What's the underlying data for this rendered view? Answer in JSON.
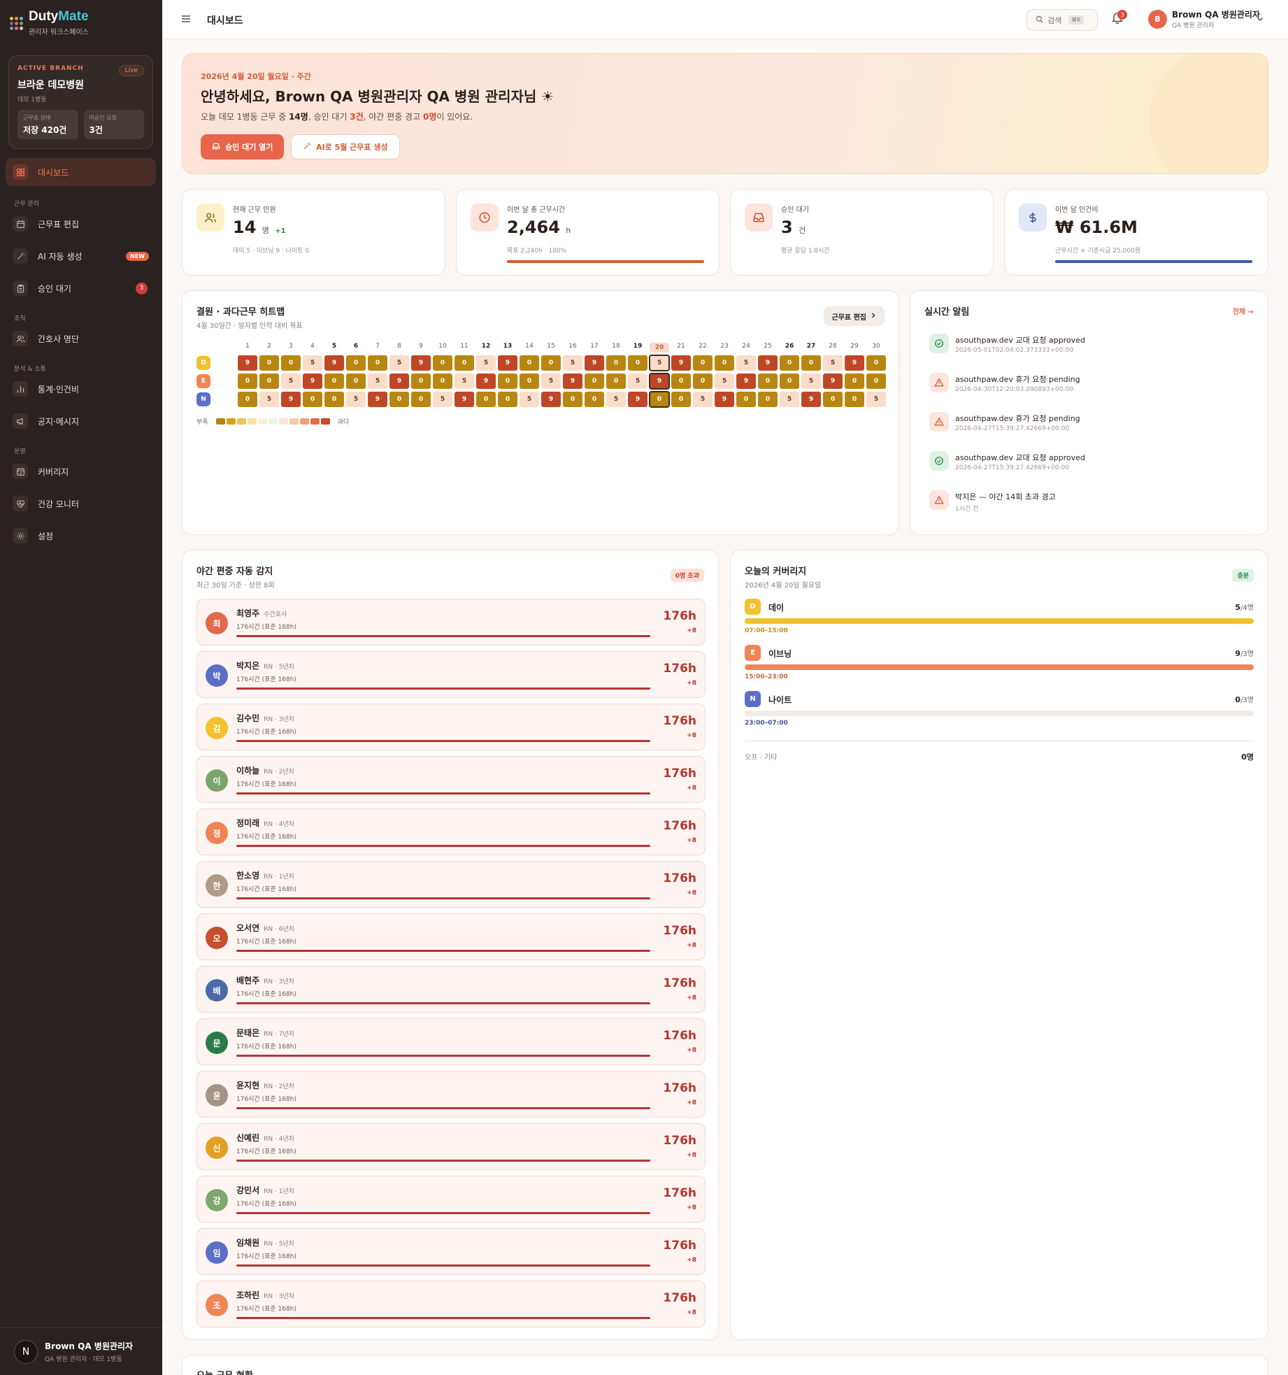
{
  "app": {
    "name_a": "Duty",
    "name_b": "Mate",
    "subtitle": "관리자 워크스페이스"
  },
  "branch": {
    "tag": "ACTIVE BRANCH",
    "live": "Live",
    "name": "브라운 데모병원",
    "unit": "데모 1병동",
    "stats": [
      {
        "label": "근무표 상태",
        "value": "저장 420건"
      },
      {
        "label": "미승인 요청",
        "value": "3건"
      }
    ]
  },
  "nav": {
    "dashboard": "대시보드",
    "sec_work": "근무 관리",
    "schedule_edit": "근무표 편집",
    "ai_gen": "AI 자동 생성",
    "new_badge": "NEW",
    "approvals": "승인 대기",
    "approvals_count": "3",
    "sec_org": "조직",
    "nurse_roster": "간호사 명단",
    "sec_analytics": "분석 & 소통",
    "stats": "통계·인건비",
    "notices": "공지·메시지",
    "sec_ops": "운영",
    "coverage": "커버리지",
    "health": "건강 모니터",
    "settings": "설정"
  },
  "sidebar_user": {
    "initial": "N",
    "name": "Brown QA 병원관리자",
    "role": "QA 병원 관리자 · 데모 1병동"
  },
  "topbar": {
    "title": "대시보드",
    "search": "검색",
    "kbd": "⌘K",
    "bell_count": "3",
    "avatar": "B",
    "user_name": "Brown QA 병원관리자",
    "user_role": "QA 병원 관리자"
  },
  "hero": {
    "date": "2026년 4월 20일 월요일 · 주간",
    "title": "안녕하세요, Brown QA 병원관리자 QA 병원 관리자님 ☀",
    "sub_1": "오늘 데모 1병동 근무 중 ",
    "sub_2": "14명",
    "sub_3": ", 승인 대기 ",
    "sub_4": "3건",
    "sub_5": ", 야간 편중 경고 ",
    "sub_6": "0명",
    "sub_7": "이 있어요.",
    "btn_primary": "승인 대기 열기",
    "btn_secondary": "AI로 5월 근무표 생성"
  },
  "kpis": [
    {
      "label": "현재 근무 인원",
      "value": "14",
      "unit": "명",
      "delta": "+1",
      "sub": "데이 5 · 이브닝 9 · 나이트 0"
    },
    {
      "label": "이번 달 총 근무시간",
      "value": "2,464",
      "unit": "h",
      "sub": "목표 2,240h · 100%",
      "progress": 1.0
    },
    {
      "label": "승인 대기",
      "value": "3",
      "unit": "건",
      "sub": "평균 응답 1.8시간"
    },
    {
      "label": "이번 달 인건비",
      "value": "₩ 61.6M",
      "sub": "근무시간 × 기준시급 25,000원",
      "progress": 1.0
    }
  ],
  "heatmap": {
    "title": "결원 · 과다근무 히트맵",
    "subtitle": "4월 30일간 · 일자별 인력 대비 목표",
    "edit_btn": "근무표 편집",
    "days": [
      "1",
      "2",
      "3",
      "4",
      "5",
      "6",
      "7",
      "8",
      "9",
      "10",
      "11",
      "12",
      "13",
      "14",
      "15",
      "16",
      "17",
      "18",
      "19",
      "20",
      "21",
      "22",
      "23",
      "24",
      "25",
      "26",
      "27",
      "28",
      "29",
      "30"
    ],
    "bold_days": [
      5,
      6,
      12,
      13,
      19,
      20,
      26,
      27
    ],
    "today": 20,
    "rows": [
      {
        "label": "D",
        "color": "#f2c12e",
        "values": [
          "9",
          "0",
          "0",
          "5",
          "9",
          "0",
          "0",
          "5",
          "9",
          "0",
          "0",
          "5",
          "9",
          "0",
          "0",
          "5",
          "9",
          "0",
          "0",
          "5",
          "9",
          "0",
          "0",
          "5",
          "9",
          "0",
          "0",
          "5",
          "9",
          "0"
        ]
      },
      {
        "label": "E",
        "color": "#ef8455",
        "values": [
          "0",
          "0",
          "5",
          "9",
          "0",
          "0",
          "5",
          "9",
          "0",
          "0",
          "5",
          "9",
          "0",
          "0",
          "5",
          "9",
          "0",
          "0",
          "5",
          "9",
          "0",
          "0",
          "5",
          "9",
          "0",
          "0",
          "5",
          "9",
          "0",
          "0"
        ]
      },
      {
        "label": "N",
        "color": "#5b6fc7",
        "values": [
          "0",
          "5",
          "9",
          "0",
          "0",
          "5",
          "9",
          "0",
          "0",
          "5",
          "9",
          "0",
          "0",
          "5",
          "9",
          "0",
          "0",
          "5",
          "9",
          "0",
          "0",
          "5",
          "9",
          "0",
          "0",
          "5",
          "9",
          "0",
          "0",
          "5"
        ]
      }
    ],
    "legend_low": "부족",
    "legend_high": "과다",
    "legend_colors": [
      "#b4830e",
      "#d9a11a",
      "#ecc65a",
      "#f6e2a4",
      "#fbf1d6",
      "#e8f5ea",
      "#fde4d6",
      "#f8c8b0",
      "#f1a07c",
      "#e26d43",
      "#c84a2a"
    ]
  },
  "alerts": {
    "title": "실시간 알림",
    "all": "전체 →",
    "items": [
      {
        "type": "ok",
        "text": "asouthpaw.dev 교대 요청 approved",
        "time": "2026-05-01T02:04:02.373333+00:00"
      },
      {
        "type": "warn",
        "text": "asouthpaw.dev 휴가 요청 pending",
        "time": "2026-04-30T12:20:03.090893+00:00"
      },
      {
        "type": "warn",
        "text": "asouthpaw.dev 휴가 요청 pending",
        "time": "2026-04-27T15:39:27.42669+00:00"
      },
      {
        "type": "ok",
        "text": "asouthpaw.dev 교대 요청 approved",
        "time": "2026-04-27T15:39:27.42669+00:00"
      },
      {
        "type": "warn",
        "text": "박지은 — 야간 14회 초과 경고",
        "time": "1시간 전"
      }
    ]
  },
  "overtime": {
    "title": "야간 편중 자동 감지",
    "subtitle": "최근 30일 기준 · 상한 8회",
    "badge": "0명 초과",
    "nurses": [
      {
        "initial": "최",
        "name": "최영주",
        "role": "수간호사",
        "hours": "176시간 (표준 168h)",
        "value": "176h",
        "plus": "+8",
        "color": "#e2694a"
      },
      {
        "initial": "박",
        "name": "박지은",
        "role": "RN · 5년차",
        "hours": "176시간 (표준 168h)",
        "value": "176h",
        "plus": "+8",
        "color": "#5b6fc7"
      },
      {
        "initial": "김",
        "name": "김수민",
        "role": "RN · 3년차",
        "hours": "176시간 (표준 168h)",
        "value": "176h",
        "plus": "+8",
        "color": "#f2c12e"
      },
      {
        "initial": "이",
        "name": "이하늘",
        "role": "RN · 2년차",
        "hours": "176시간 (표준 168h)",
        "value": "176h",
        "plus": "+8",
        "color": "#7aa56c"
      },
      {
        "initial": "정",
        "name": "정미래",
        "role": "RN · 4년차",
        "hours": "176시간 (표준 168h)",
        "value": "176h",
        "plus": "+8",
        "color": "#ef8455"
      },
      {
        "initial": "한",
        "name": "한소영",
        "role": "RN · 1년차",
        "hours": "176시간 (표준 168h)",
        "value": "176h",
        "plus": "+8",
        "color": "#b29a86"
      },
      {
        "initial": "오",
        "name": "오서연",
        "role": "RN · 6년차",
        "hours": "176시간 (표준 168h)",
        "value": "176h",
        "plus": "+8",
        "color": "#c4502c"
      },
      {
        "initial": "배",
        "name": "배현주",
        "role": "RN · 3년차",
        "hours": "176시간 (표준 168h)",
        "value": "176h",
        "plus": "+8",
        "color": "#4b6aa6"
      },
      {
        "initial": "문",
        "name": "문태은",
        "role": "RN · 7년차",
        "hours": "176시간 (표준 168h)",
        "value": "176h",
        "plus": "+8",
        "color": "#2a7a45"
      },
      {
        "initial": "윤",
        "name": "윤지현",
        "role": "RN · 2년차",
        "hours": "176시간 (표준 168h)",
        "value": "176h",
        "plus": "+8",
        "color": "#a29385"
      },
      {
        "initial": "신",
        "name": "신예린",
        "role": "RN · 4년차",
        "hours": "176시간 (표준 168h)",
        "value": "176h",
        "plus": "+8",
        "color": "#e0a124"
      },
      {
        "initial": "강",
        "name": "강민서",
        "role": "RN · 1년차",
        "hours": "176시간 (표준 168h)",
        "value": "176h",
        "plus": "+8",
        "color": "#7fa870"
      },
      {
        "initial": "임",
        "name": "임채원",
        "role": "RN · 5년차",
        "hours": "176시간 (표준 168h)",
        "value": "176h",
        "plus": "+8",
        "color": "#5b6fc7"
      },
      {
        "initial": "조",
        "name": "조하린",
        "role": "RN · 3년차",
        "hours": "176시간 (표준 168h)",
        "value": "176h",
        "plus": "+8",
        "color": "#ef8455"
      }
    ]
  },
  "coverage": {
    "title": "오늘의 커버리지",
    "subtitle": "2026년 4월 20일 월요일",
    "badge": "충분",
    "shifts": [
      {
        "code": "D",
        "name": "데이",
        "count": "5",
        "target": "/4명",
        "time": "07:00–15:00",
        "fill": 1.0,
        "color": "#f2c12e",
        "time_color": "#c98f0e"
      },
      {
        "code": "E",
        "name": "이브닝",
        "count": "9",
        "target": "/3명",
        "time": "15:00–23:00",
        "fill": 1.0,
        "color": "#ef8455",
        "time_color": "#d0603e"
      },
      {
        "code": "N",
        "name": "나이트",
        "count": "0",
        "target": "/3명",
        "time": "23:00–07:00",
        "fill": 0.0,
        "color": "#5b6fc7",
        "time_color": "#3f4f9a"
      }
    ],
    "off_label": "오프 · 기타",
    "off_value": "0명"
  },
  "today_status": {
    "title": "오늘 근무 현황"
  }
}
